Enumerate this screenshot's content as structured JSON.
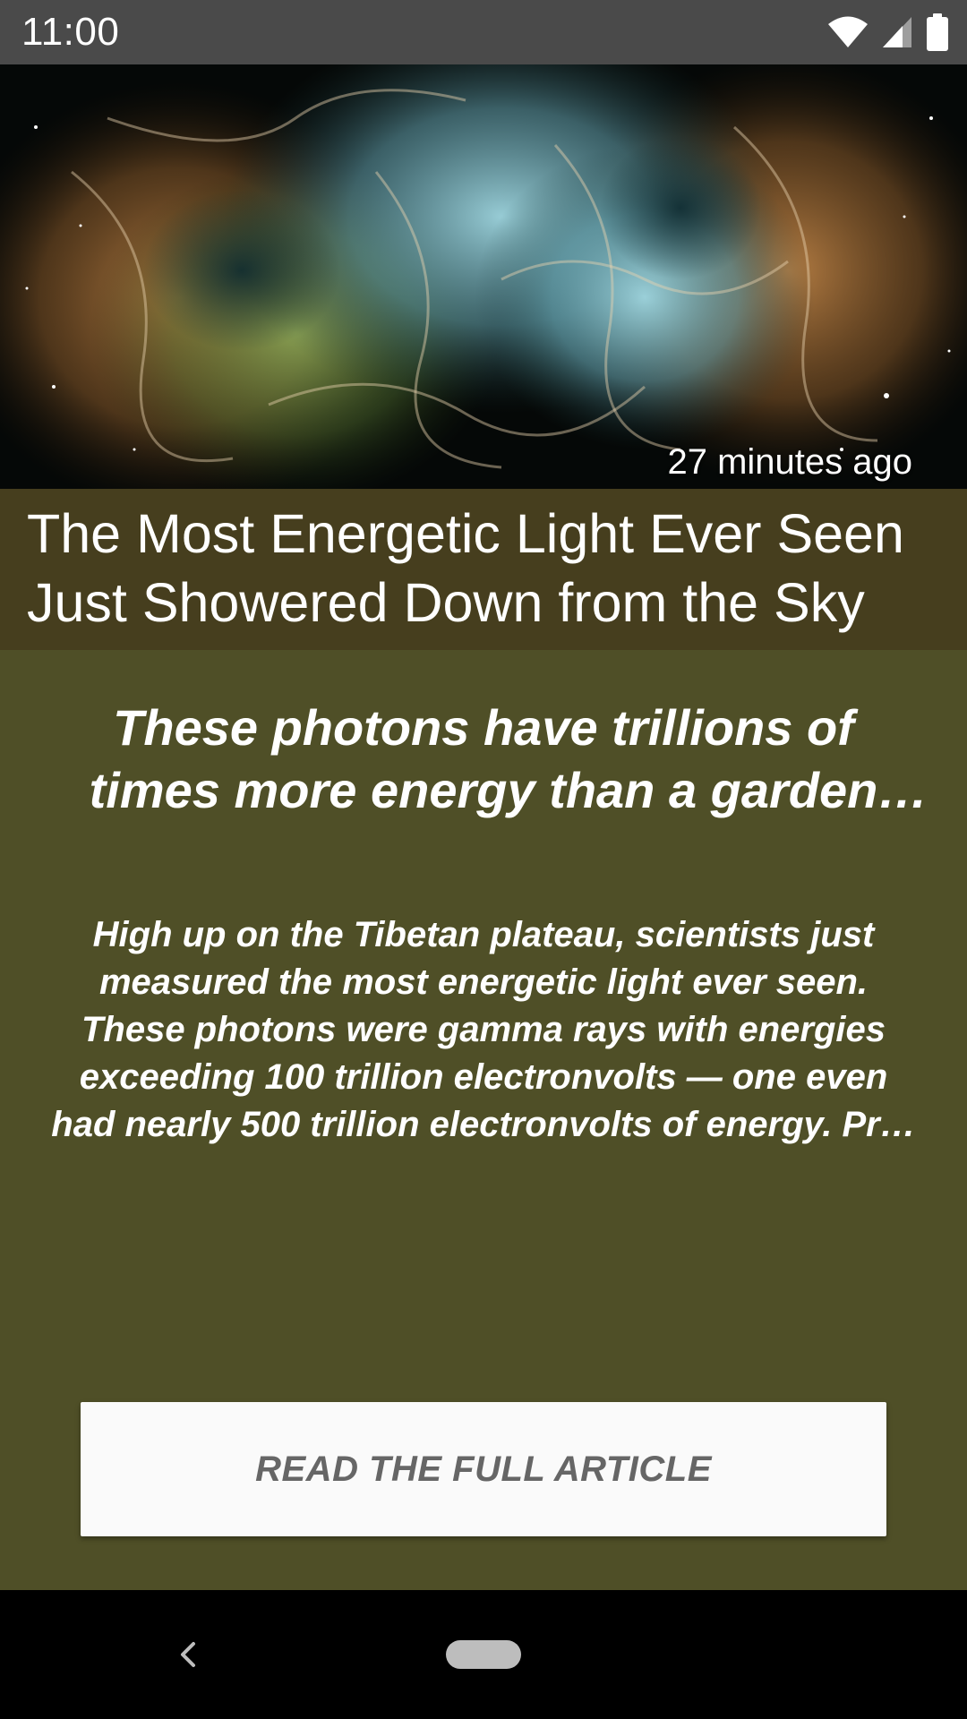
{
  "status_bar": {
    "time": "11:00",
    "icons": [
      "wifi-icon",
      "cellular-signal-icon",
      "battery-icon"
    ]
  },
  "hero": {
    "image": "crab-nebula-image",
    "timestamp": "27 minutes ago"
  },
  "article": {
    "title": "The Most Energetic Light Ever Seen Just Showered Down from the Sky Above Tibet — Live",
    "subtitle": "These photons have trillions of times more energy than a garden variety li…",
    "summary": "High up on the Tibetan plateau, scientists just measured the most energetic light ever seen. These photons were gamma rays with energies exceeding 100 trillion electronvolts — one even had nearly 500 trillion electronvolts of energy. Pr…",
    "read_button_label": "READ THE FULL ARTICLE"
  },
  "nav_bar": {
    "icons": [
      "back-icon",
      "home-pill-icon"
    ]
  },
  "colors": {
    "status_bar_bg": "#4a4a4a",
    "title_band_bg": "#463e1e",
    "content_bg": "#4f4f27",
    "button_bg": "#fafafa",
    "button_text": "#666666",
    "nav_bar_bg": "#000000"
  }
}
